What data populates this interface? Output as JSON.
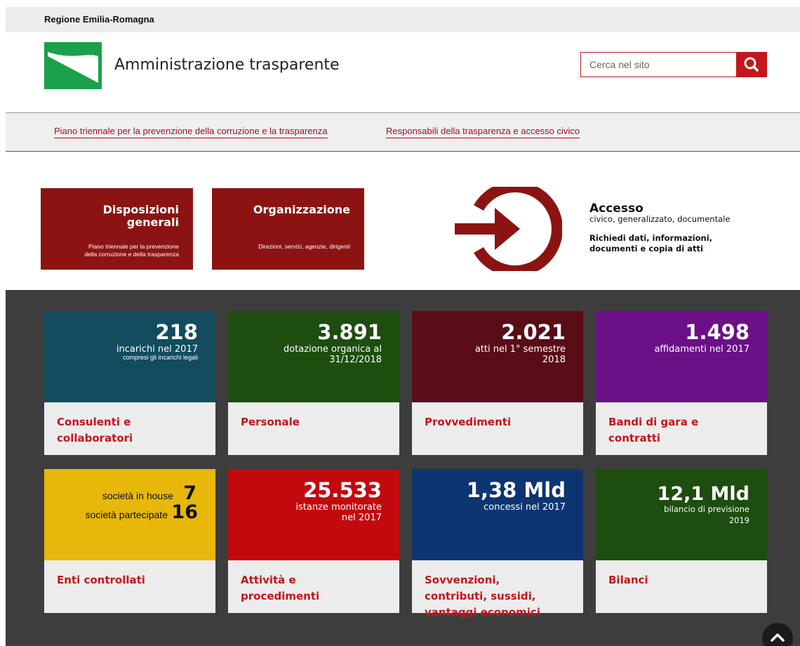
{
  "topbar": {
    "region": "Regione Emilia-Romagna"
  },
  "header": {
    "title": "Amministrazione trasparente"
  },
  "search": {
    "placeholder": "Cerca nel sito",
    "button_icon": "search-icon"
  },
  "links": [
    "Piano triennale per la prevenzione della corruzione e la trasparenza",
    "Responsabili della trasparenza e accesso civico"
  ],
  "tiles": [
    {
      "title_line1": "Disposizioni",
      "title_line2": "generali",
      "sub_line1": "Piano triennale per la prevenzione",
      "sub_line2": "della corruzione e della trasparenza"
    },
    {
      "title_line1": "Organizzazione",
      "sub_line1": "Direzioni, servizi, agenzie, dirigenti"
    }
  ],
  "access": {
    "title": "Accesso",
    "subtitle": "civico, generalizzato, documentale",
    "cta_line1": "Richiedi dati, informazioni,",
    "cta_line2": "documenti e copia di atti"
  },
  "cards": [
    {
      "number": "218",
      "desc": "incarichi nel 2017",
      "desc_small": "compresi gli incarichi legali",
      "label_line1": "Consulenti e",
      "label_line2": "collaboratori",
      "color": "#124c5e"
    },
    {
      "number": "3.891",
      "desc_line1": "dotazione organica al",
      "desc_line2": "31/12/2018",
      "label_line1": "Personale",
      "color": "#1d4d0f"
    },
    {
      "number": "2.021",
      "desc_line1": "atti nel 1° semestre",
      "desc_line2": "2018",
      "label_line1": "Provvedimenti",
      "color": "#5a0c17"
    },
    {
      "number": "1.498",
      "desc": "affidamenti nel 2017",
      "label_line1": "Bandi di gara e",
      "label_line2": "contratti",
      "color": "#6b0f86"
    },
    {
      "inhouse_label": "società in house",
      "inhouse_num": "7",
      "partecipate_label": "società partecipate",
      "partecipate_num": "16",
      "label_line1": "Enti controllati",
      "color": "#e7b70a"
    },
    {
      "number": "25.533",
      "desc_line1": "istanze monitorate",
      "desc_line2": "nel 2017",
      "label_line1": "Attività e",
      "label_line2": "procedimenti",
      "color": "#c20a0e"
    },
    {
      "number": "1,38 Mld",
      "desc": "concessi nel 2017",
      "label_line1": "Sovvenzioni,",
      "label_line2": "contributi, sussidi,",
      "label_line3": "vantaggi economici",
      "color": "#0d3572"
    },
    {
      "number": "12,1 Mld",
      "desc_line1": "bilancio di previsione",
      "desc_line2": "2019",
      "label_line1": "Bilanci",
      "color": "#1d4d0f"
    }
  ],
  "colors": {
    "accent": "#c4161c",
    "tile": "#8b1412",
    "dark_band": "#3d3d3d",
    "logo_green": "#1aa14a"
  },
  "scroll_top_icon": "chevron-up-icon"
}
